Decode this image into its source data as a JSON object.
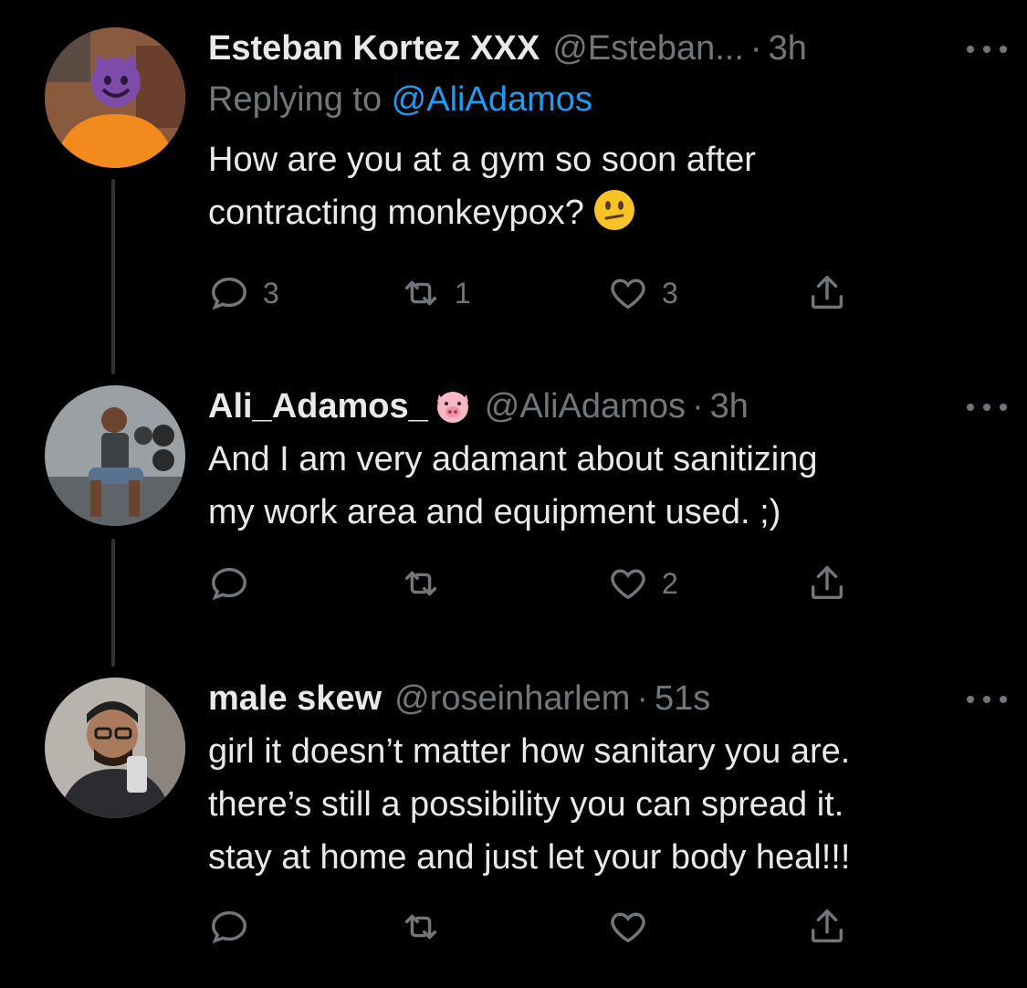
{
  "tweets": [
    {
      "name": "Esteban Kortez XXX",
      "name_emoji": "",
      "handle": "@Esteban...",
      "dot": "·",
      "time": "3h",
      "replying_label": "Replying to ",
      "replying_to": "@AliAdamos",
      "text_lines": [
        "How are you at a gym so soon after",
        "contracting monkeypox?"
      ],
      "text_emoji": "confused-face-emoji",
      "avatar_emoji": "smiling-face-with-horns-emoji",
      "replies": "3",
      "retweets": "1",
      "likes": "3"
    },
    {
      "name": "Ali_Adamos_",
      "name_emoji": "pig-face-emoji",
      "handle": "@AliAdamos",
      "dot": "·",
      "time": "3h",
      "text_lines": [
        "And I am very adamant about sanitizing",
        "my work area and equipment used. ;)"
      ],
      "replies": "",
      "retweets": "",
      "likes": "2"
    },
    {
      "name": "male skew",
      "handle": "@roseinharlem",
      "dot": "·",
      "time": "51s",
      "text_lines": [
        "girl it doesn’t matter how sanitary you are.",
        "there’s still a possibility you can spread it.",
        "stay at home and just let your body heal!!!"
      ],
      "replies": "",
      "retweets": "",
      "likes": ""
    }
  ],
  "colors": {
    "background": "#000000",
    "primary_text": "#e7e9ea",
    "secondary_text": "#71767b",
    "link": "#1d9bf0",
    "thread_line": "#2f3336"
  }
}
